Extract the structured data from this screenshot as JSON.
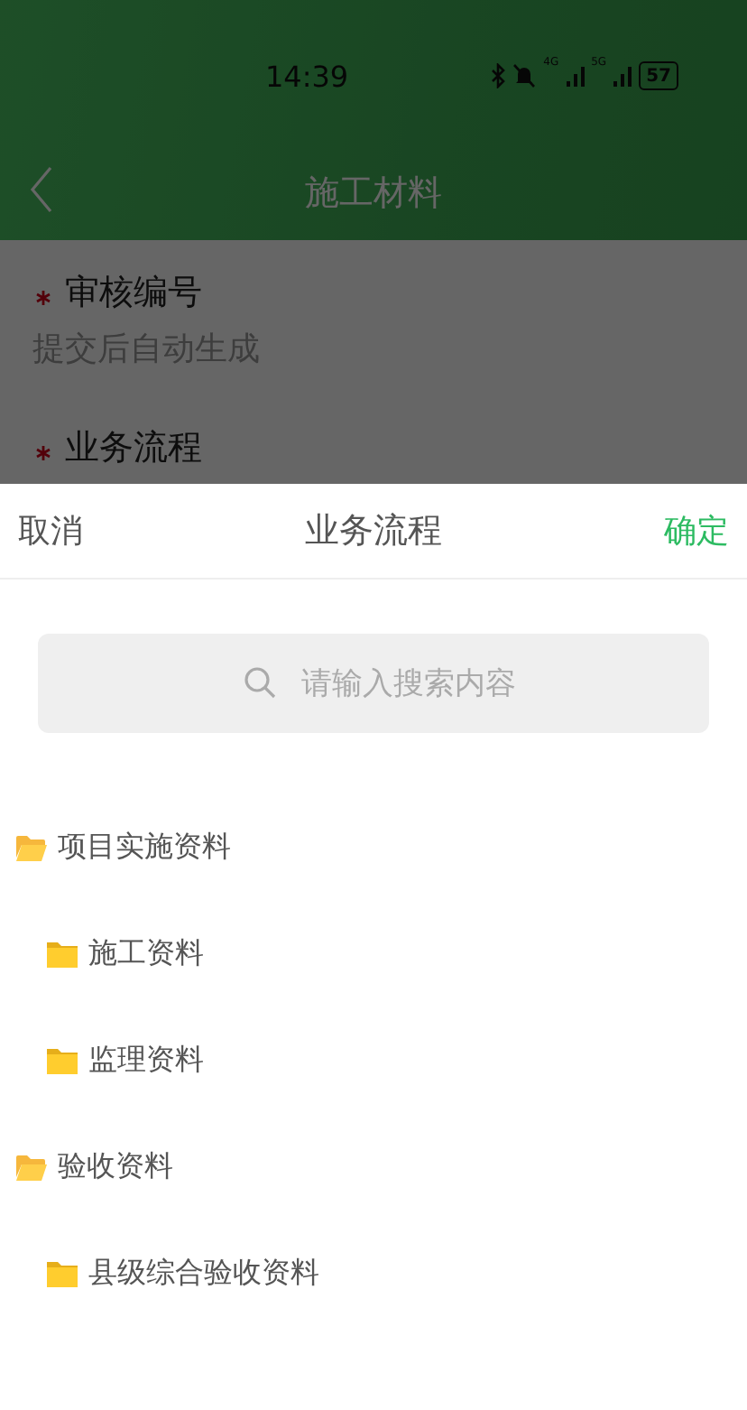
{
  "status_bar": {
    "time": "14:39",
    "network_1": "4G",
    "network_2": "5G",
    "battery": "57"
  },
  "header": {
    "title": "施工材料"
  },
  "form": {
    "fields": [
      {
        "label": "审核编号",
        "required": true,
        "value": "提交后自动生成"
      },
      {
        "label": "业务流程",
        "required": true
      }
    ]
  },
  "picker": {
    "cancel": "取消",
    "title": "业务流程",
    "confirm": "确定",
    "search": {
      "placeholder": "请输入搜索内容"
    },
    "tree": [
      {
        "label": "项目实施资料",
        "expanded": true,
        "children": [
          {
            "label": "施工资料",
            "expanded": false
          },
          {
            "label": "监理资料",
            "expanded": false
          }
        ]
      },
      {
        "label": "验收资料",
        "expanded": true,
        "children": [
          {
            "label": "县级综合验收资料",
            "expanded": false
          }
        ]
      }
    ]
  }
}
